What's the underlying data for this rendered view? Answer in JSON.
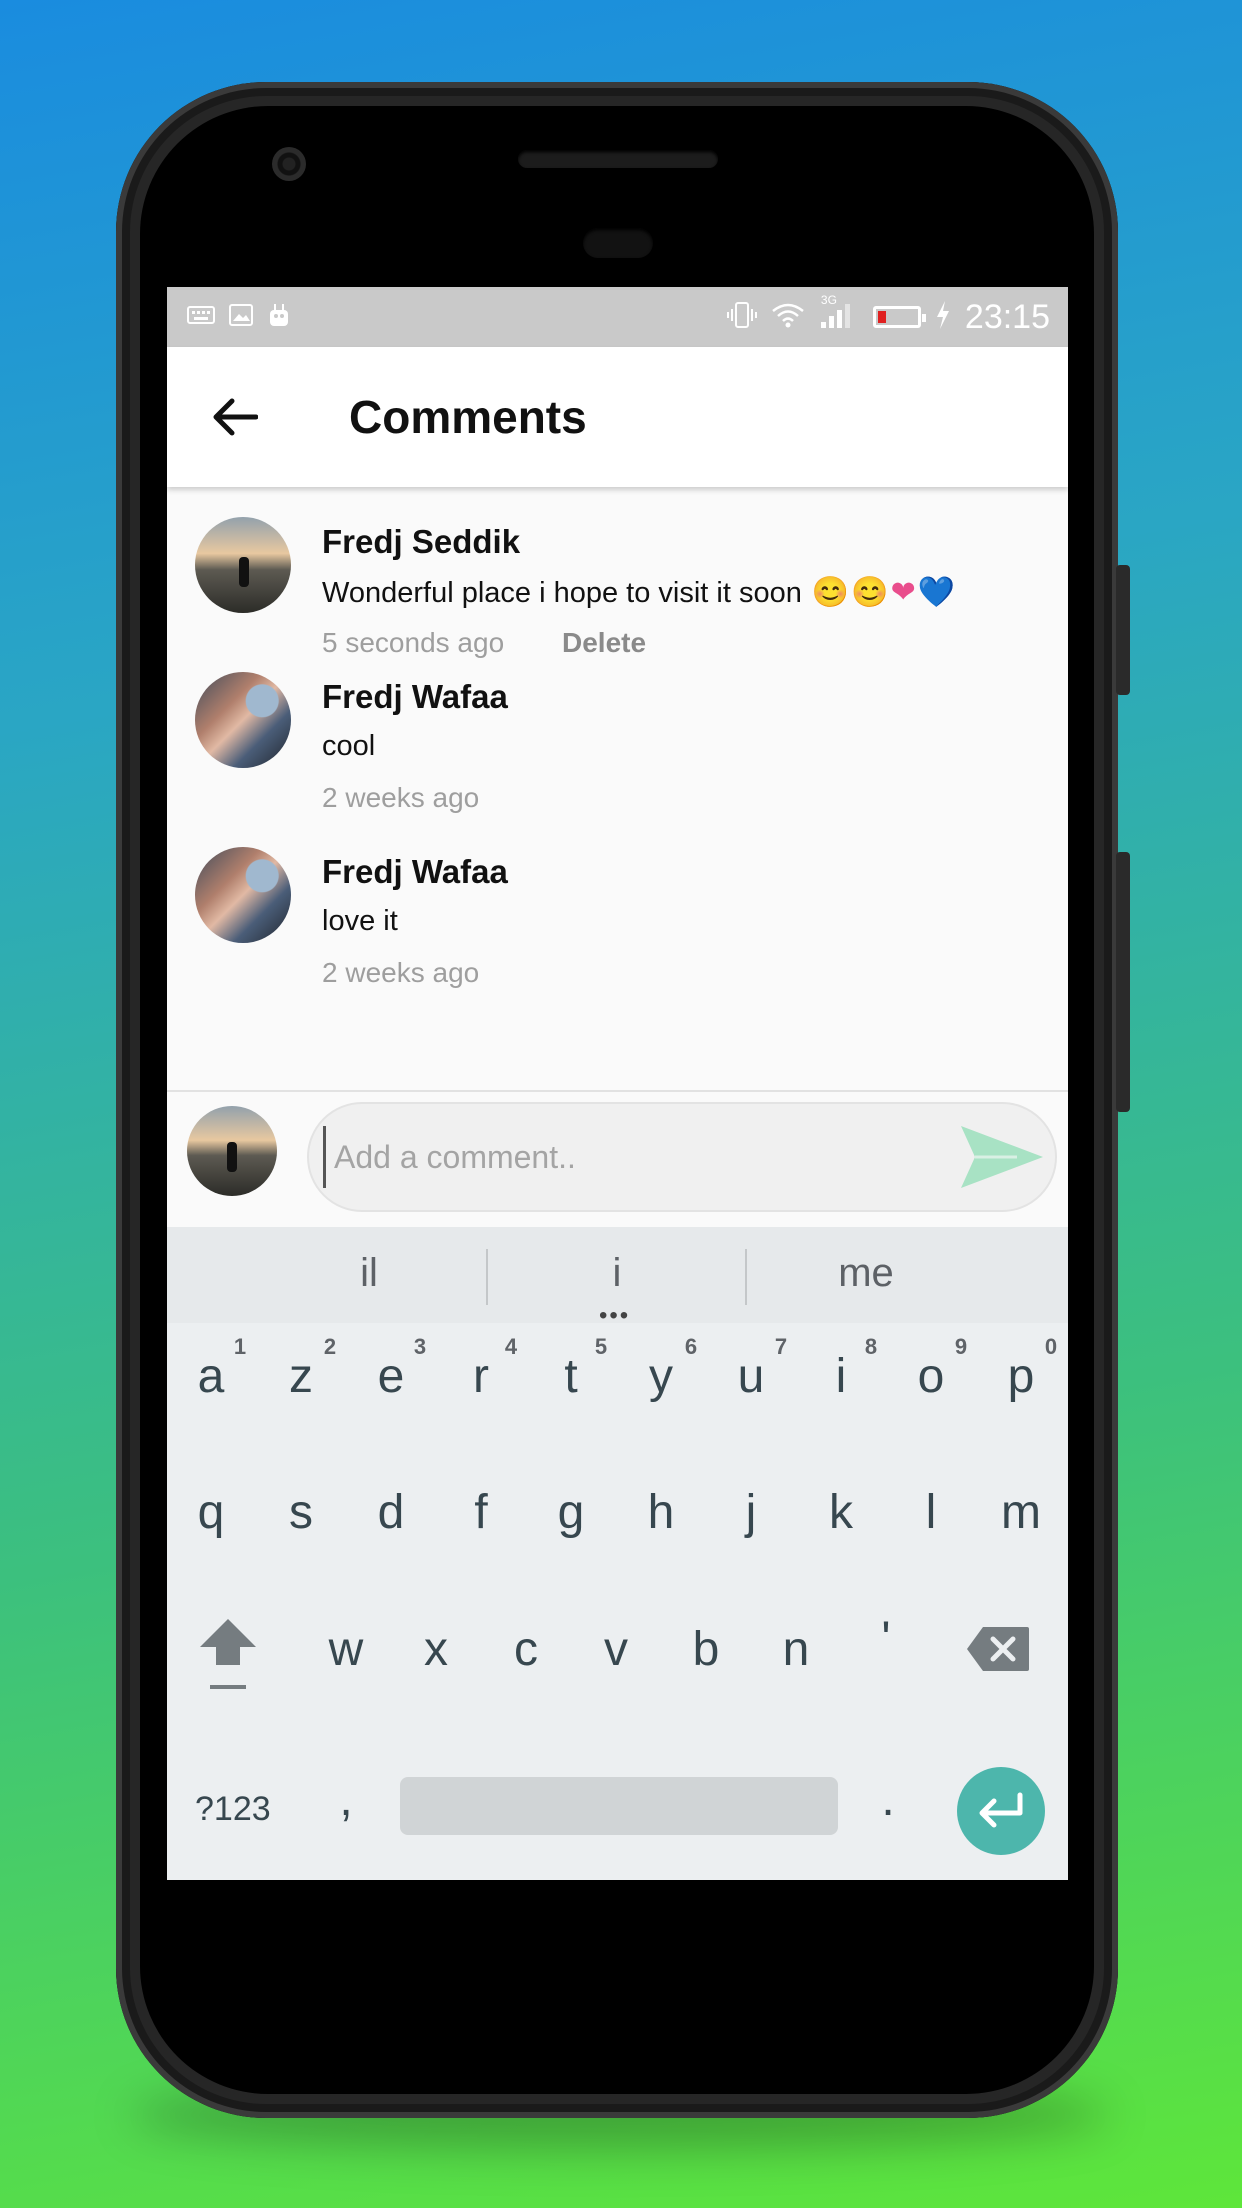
{
  "status_bar": {
    "time": "23:15",
    "network": "3G"
  },
  "app_bar": {
    "title": "Comments"
  },
  "comments": [
    {
      "author": "Fredj  Seddik",
      "text": "Wonderful place i hope to visit it soon",
      "emojis": [
        "😊",
        "😊",
        "❤",
        "💙"
      ],
      "time": "5 seconds ago",
      "delete_label": "Delete"
    },
    {
      "author": "Fredj Wafaa",
      "text": "cool",
      "time": "2 weeks ago"
    },
    {
      "author": "Fredj Wafaa",
      "text": "love it",
      "time": "2 weeks ago"
    }
  ],
  "composer": {
    "placeholder": "Add a comment..",
    "value": ""
  },
  "keyboard": {
    "suggestions": [
      "il",
      "i",
      "me"
    ],
    "row1": [
      "a",
      "z",
      "e",
      "r",
      "t",
      "y",
      "u",
      "i",
      "o",
      "p"
    ],
    "row1_hints": [
      "1",
      "2",
      "3",
      "4",
      "5",
      "6",
      "7",
      "8",
      "9",
      "0"
    ],
    "row2": [
      "q",
      "s",
      "d",
      "f",
      "g",
      "h",
      "j",
      "k",
      "l",
      "m"
    ],
    "row3": [
      "w",
      "x",
      "c",
      "v",
      "b",
      "n",
      "'"
    ],
    "symbols_key": "?123",
    "comma": ",",
    "period": "."
  },
  "colors": {
    "accent": "#4db6ac",
    "send_icon": "#a8e2c4",
    "status_bar": "#c9c9c9",
    "battery_low": "#e02020"
  },
  "icons": [
    "back-arrow-icon",
    "send-icon",
    "shift-icon",
    "backspace-icon",
    "enter-icon",
    "wifi-icon",
    "signal-icon",
    "battery-icon",
    "vibrate-icon",
    "keyboard-icon",
    "image-icon",
    "android-icon",
    "charging-icon"
  ]
}
